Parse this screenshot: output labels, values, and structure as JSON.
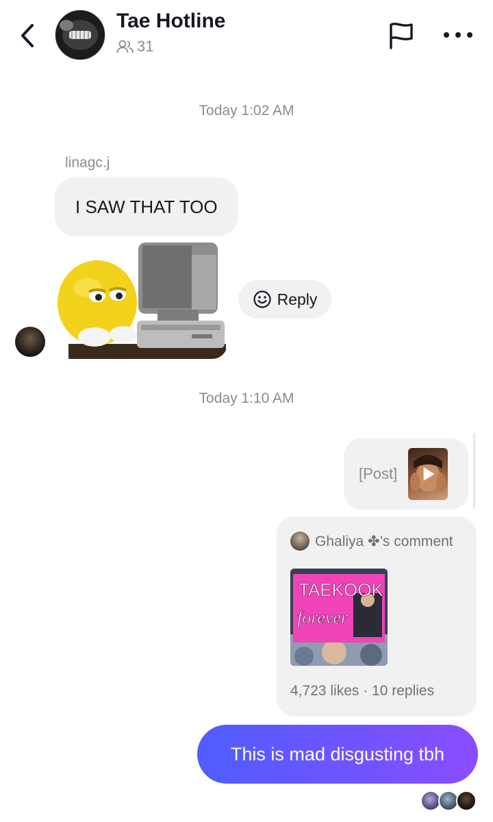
{
  "header": {
    "title": "Tae Hotline",
    "member_count": "31",
    "icons": [
      "chevron-left-icon",
      "group-icon",
      "flag-icon",
      "more-icon"
    ]
  },
  "messages": {
    "timestamp1": "Today 1:02 AM",
    "sender_name": "linagc.j",
    "incoming_text": "I SAW THAT TOO",
    "reply_label": "Reply",
    "timestamp2": "Today 1:10 AM",
    "post_label": "[Post]",
    "comment": {
      "header": "Ghaliya ✤’s comment",
      "image_text_line1": "TAEKOOK",
      "image_text_line2": "forever",
      "stats": "4,723 likes · 10 replies"
    },
    "outgoing_text": "This is mad disgusting tbh"
  },
  "colors": {
    "bubble_gray": "#f1f1f2",
    "outgoing_gradient_start": "#4f5dff",
    "outgoing_gradient_end": "#8a4dff",
    "muted_text": "#8a8b91"
  }
}
